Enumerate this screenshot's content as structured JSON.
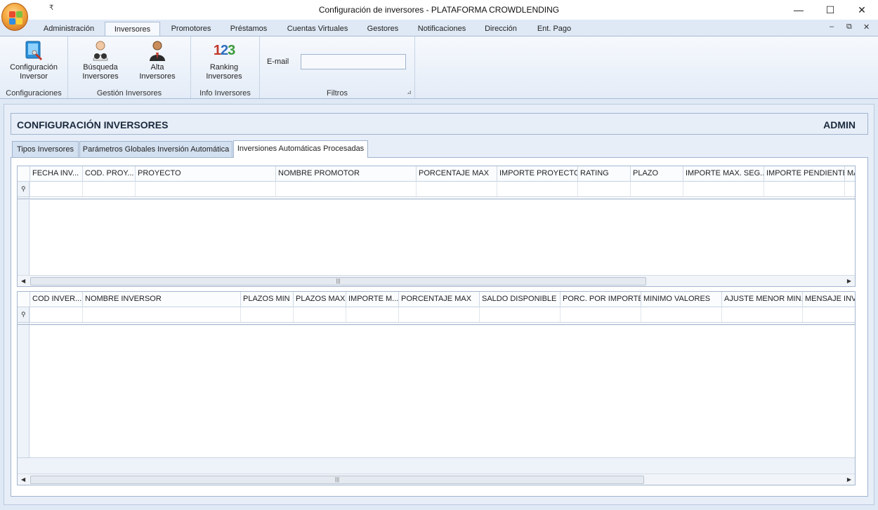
{
  "window": {
    "title": "Configuración de inversores - PLATAFORMA CROWDLENDING",
    "minimize": "—",
    "maximize": "☐",
    "close": "✕",
    "quick_access": "₹"
  },
  "ribbon_tabs": [
    "Administración",
    "Inversores",
    "Promotores",
    "Préstamos",
    "Cuentas Virtuales",
    "Gestores",
    "Notificaciones",
    "Dirección",
    "Ent. Pago"
  ],
  "active_ribbon_tab": "Inversores",
  "mdi_controls": {
    "minimize": "–",
    "restore": "⧉",
    "close": "✕"
  },
  "ribbon_groups": {
    "configuraciones": {
      "label": "Configuraciones",
      "buttons": [
        {
          "label_line1": "Configuración",
          "label_line2": "Inversor",
          "icon": "monitor-config-icon"
        }
      ]
    },
    "gestion": {
      "label": "Gestión Inversores",
      "buttons": [
        {
          "label_line1": "Búsqueda",
          "label_line2": "Inversores",
          "icon": "binoculars-person-icon"
        },
        {
          "label_line1": "Alta",
          "label_line2": "Inversores",
          "icon": "person-add-icon"
        }
      ]
    },
    "info": {
      "label": "Info Inversores",
      "buttons": [
        {
          "label_line1": "Ranking",
          "label_line2": "Inversores",
          "icon": "ranking-123-icon",
          "glyph": [
            "1",
            "2",
            "3"
          ]
        }
      ]
    },
    "filtros": {
      "label": "Filtros",
      "email_label": "E-mail",
      "email_value": "",
      "launcher": "⊿"
    }
  },
  "panel": {
    "title": "CONFIGURACIÓN INVERSORES",
    "user": "ADMIN",
    "tabs": [
      "Tipos Inversores",
      "Parámetros Globales Inversión Automática",
      "Inversiones Automáticas Procesadas"
    ],
    "active_tab": "Inversiones Automáticas Procesadas"
  },
  "grid_top": {
    "columns": [
      "FECHA INV...",
      "COD. PROY...",
      "PROYECTO",
      "NOMBRE PROMOTOR",
      "PORCENTAJE MAX",
      "IMPORTE PROYECTO",
      "RATING",
      "PLAZO",
      "IMPORTE MAX. SEG...",
      "IMPORTE PENDIENTE",
      "MA"
    ],
    "rows": []
  },
  "grid_bottom": {
    "columns": [
      "COD INVER...",
      "NOMBRE INVERSOR",
      "PLAZOS MIN",
      "PLAZOS MAX",
      "IMPORTE M...",
      "PORCENTAJE MAX",
      "SALDO DISPONIBLE",
      "PORC. POR IMPORTE",
      "MINIMO VALORES",
      "AJUSTE MENOR MIN.",
      "MENSAJE INVER"
    ],
    "rows": []
  },
  "scrollbar": {
    "left": "◀",
    "right": "▶",
    "grip": "|||"
  },
  "filter_pin": "⚲"
}
